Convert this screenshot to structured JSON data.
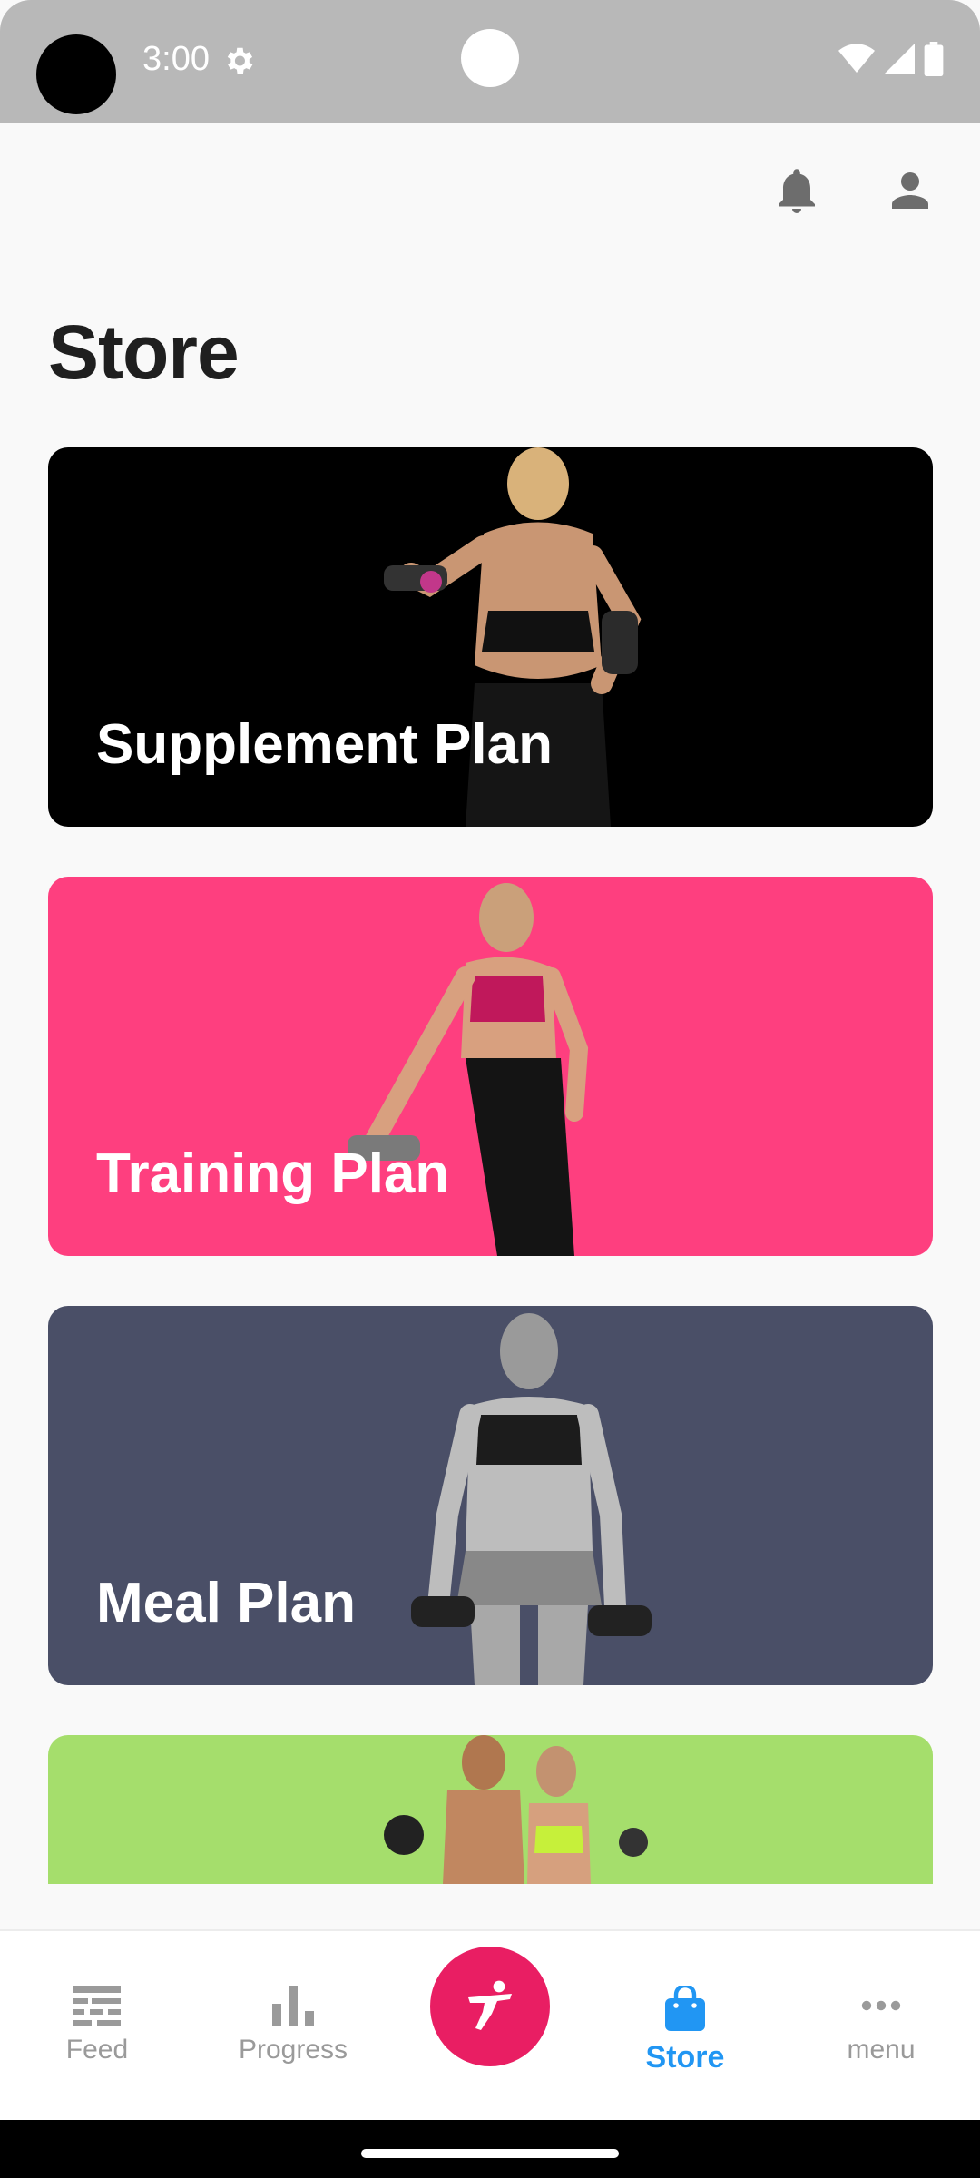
{
  "status_bar": {
    "time": "3:00"
  },
  "page": {
    "title": "Store"
  },
  "cards": [
    {
      "label": "Supplement Plan",
      "background": "#000000"
    },
    {
      "label": "Training Plan",
      "background": "#fe3f7f"
    },
    {
      "label": "Meal Plan",
      "background": "#4a4f67"
    },
    {
      "label": "",
      "background": "#a5de6c"
    }
  ],
  "bottom_nav": {
    "items": [
      {
        "label": "Feed",
        "icon": "feed-icon"
      },
      {
        "label": "Progress",
        "icon": "bar-chart-icon"
      },
      {
        "label": "Store",
        "icon": "shopping-bag-icon",
        "active": true
      },
      {
        "label": "menu",
        "icon": "more-horizontal-icon"
      }
    ],
    "fab_icon": "kick-icon"
  },
  "colors": {
    "accent": "#2196f3",
    "fab": "#e91e63"
  }
}
